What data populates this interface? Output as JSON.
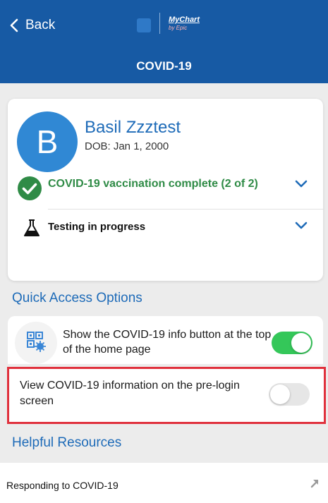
{
  "header": {
    "back_label": "Back",
    "brand_line1": "MyChart",
    "brand_line2": "by Epic",
    "title": "COVID-19"
  },
  "patient": {
    "initial": "B",
    "name": "Basil Zzztest",
    "dob": "DOB: Jan 1, 2000"
  },
  "status_rows": [
    {
      "label": "COVID-19 vaccination complete (2 of 2)",
      "icon": "check-circle-icon",
      "color": "#2f8b46"
    },
    {
      "label": "Testing in progress",
      "icon": "flask-icon"
    }
  ],
  "quick_access": {
    "heading": "Quick Access Options",
    "options": [
      {
        "label": "Show the COVID-19 info button at the top of the home page",
        "enabled": true
      },
      {
        "label": "View COVID-19 information on the pre-login screen",
        "enabled": false
      }
    ]
  },
  "helpful_resources": {
    "heading": "Helpful Resources",
    "items": [
      {
        "label": "Responding to COVID-19",
        "icon": "external-link-icon"
      }
    ]
  },
  "colors": {
    "header_bg": "#175aa4",
    "accent_blue": "#1e6bb8",
    "success_green": "#2f8b46",
    "toggle_on": "#34c759",
    "highlight_red": "#e0313d"
  }
}
